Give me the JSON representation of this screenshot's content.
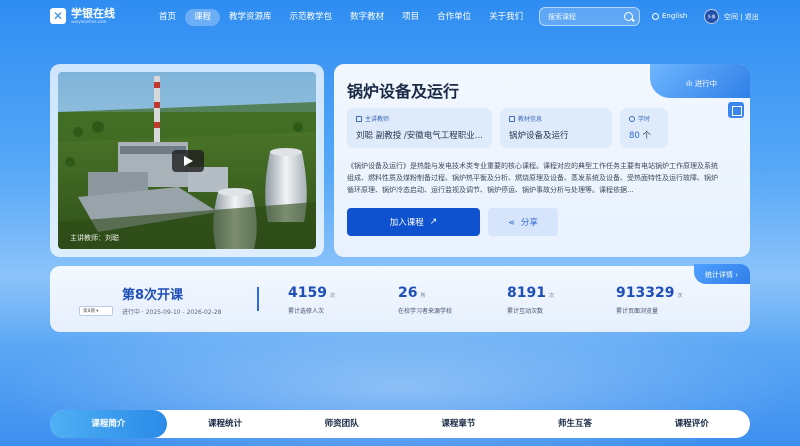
{
  "header": {
    "logo_text": "学银在线",
    "logo_sub": "xueyinonline.com",
    "nav": [
      "首页",
      "课程",
      "教学资源库",
      "示范教学包",
      "数字教材",
      "项目",
      "合作单位",
      "关于我们"
    ],
    "active_nav": 1,
    "search_placeholder": "搜索课程",
    "lang": "English",
    "avatar_text": "头像",
    "user_links": "空间 | 退出"
  },
  "video": {
    "caption": "主讲教师：刘聪"
  },
  "course": {
    "title": "锅炉设备及运行",
    "status": "进行中",
    "teacher_label": "主讲教师",
    "teacher_value": "刘聪 副教授 /安徽电气工程职业...",
    "material_label": "教材信息",
    "material_value": "锅炉设备及运行",
    "hours_label": "学时",
    "hours_value": "80",
    "hours_unit": "个",
    "description": "《锅炉设备及运行》是热能与发电技术类专业重要的核心课程。课程对应的典型工作任务主要有电站锅炉工作原理及系统组成、燃料性质及煤粉制备过程、锅炉热平衡及分析、燃烧原理及设备、蒸发系统及设备、受热面特性及运行故障、锅炉循环原理、锅炉冷态启动、运行监视及调节、锅炉停运、锅炉事故分析与处理等。课程依据...",
    "join_label": "加入课程",
    "share_label": "分享"
  },
  "stats": {
    "session_title": "第8次开课",
    "session_select": "第8期",
    "session_sub": "进行中 · 2025-09-10 - 2026-02-28",
    "detail_label": "统计详情",
    "items": [
      {
        "num": "4159",
        "unit": "次",
        "label": "累计选修人次"
      },
      {
        "num": "26",
        "unit": "所",
        "label": "在校学习者来源学校"
      },
      {
        "num": "8191",
        "unit": "次",
        "label": "累计互动次数"
      },
      {
        "num": "913329",
        "unit": "次",
        "label": "累计页面浏览量"
      }
    ]
  },
  "tabs": [
    "课程简介",
    "课程统计",
    "师资团队",
    "课程章节",
    "师生互答",
    "课程评价"
  ],
  "active_tab": 0,
  "colors": {
    "primary": "#0f52cf",
    "accent": "#2f7fe8",
    "stat_number": "#1e4fb8"
  }
}
